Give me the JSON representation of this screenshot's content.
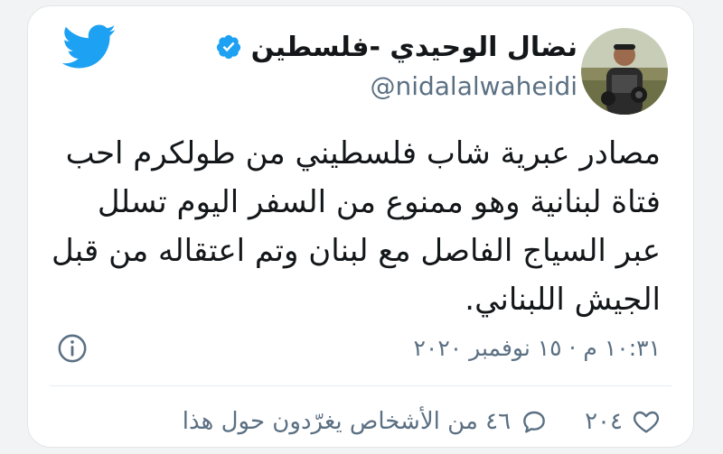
{
  "tweet": {
    "display_name": "نضال الوحيدي -فلسطين",
    "handle": "@nidalalwaheidi",
    "text_lines": [
      "مصادر عبرية شاب فلسطيني من طولكرم احب",
      "فتاة لبنانية وهو ممنوع من السفر اليوم تسلل",
      "عبر السياج الفاصل مع لبنان وتم اعتقاله من قبل",
      "الجيش اللبناني."
    ],
    "timestamp": "١٠:٣١ م · ١٥ نوفمبر ٢٠٢٠",
    "likes_count": "٢٠٤",
    "replies_label": "٤٦ من الأشخاص يغرّدون حول هذا"
  },
  "icons": {
    "logo": "twitter-bird-icon",
    "verified": "verified-badge-icon",
    "info": "info-icon",
    "like": "heart-icon",
    "reply": "speech-bubble-icon"
  },
  "colors": {
    "brand": "#1da1f2",
    "text": "#14171a",
    "secondary": "#5b7083",
    "background": "#ffffff"
  }
}
